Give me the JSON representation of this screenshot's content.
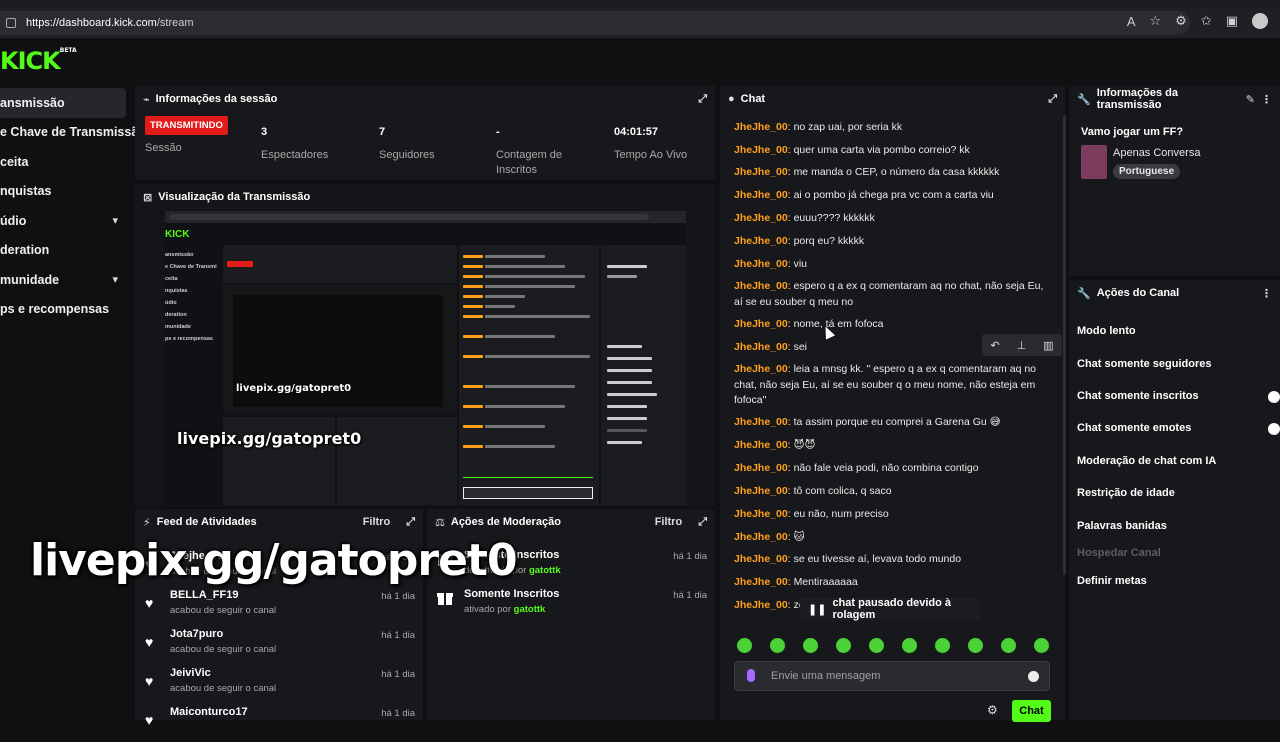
{
  "browser": {
    "url_host": "https://dashboard.kick.com",
    "url_path": "/stream"
  },
  "logo": "KICK",
  "logo_beta": "BETA",
  "sidebar": {
    "items": [
      {
        "label": "ansmissão",
        "active": true
      },
      {
        "label": "e Chave de Transmissão"
      },
      {
        "label": "ceita"
      },
      {
        "label": "nquistas"
      },
      {
        "label": "údio",
        "expandable": true
      },
      {
        "label": "deration"
      },
      {
        "label": "munidade",
        "expandable": true
      },
      {
        "label": "ps e recompensas"
      }
    ]
  },
  "session": {
    "title": "Informações da sessão",
    "status_badge": "TRANSMITINDO",
    "status_label": "Sessão",
    "viewers_value": "3",
    "viewers_label": "Espectadores",
    "followers_value": "7",
    "followers_label": "Seguidores",
    "subs_value": "-",
    "subs_label": "Contagem de Inscritos",
    "live_value": "04:01:57",
    "live_label": "Tempo Ao Vivo"
  },
  "preview": {
    "title": "Visualização da Transmissão",
    "overlay_text": "livepix.gg/gatopret0",
    "mini_url": "https://dashboard.kick.com/stream"
  },
  "feed": {
    "title": "Feed de Atividades",
    "filter": "Filtro",
    "items": [
      {
        "name": "Jhejhe_00",
        "sub": "acabou de seguir o canal",
        "time": "há 1 dia"
      },
      {
        "name": "BELLA_FF19",
        "sub": "acabou de seguir o canal",
        "time": "há 1 dia"
      },
      {
        "name": "Jota7puro",
        "sub": "acabou de seguir o canal",
        "time": "há 1 dia"
      },
      {
        "name": "JeiviVic",
        "sub": "acabou de seguir o canal",
        "time": "há 1 dia"
      },
      {
        "name": "Maiconturco17",
        "sub": "",
        "time": "há 1 dia"
      }
    ]
  },
  "moderation": {
    "title": "Ações de Moderação",
    "filter": "Filtro",
    "items": [
      {
        "name": "Somente Inscritos",
        "state": "desativado por",
        "by": "gatottk",
        "time": "há 1 dia"
      },
      {
        "name": "Somente Inscritos",
        "state": "ativado por",
        "by": "gatottk",
        "time": "há 1 dia"
      }
    ]
  },
  "overlay_big": "livepix.gg/gatopret0",
  "chat": {
    "title": "Chat",
    "messages": [
      {
        "user": "JheJhe_00",
        "text": "no zap uai, por seria kk"
      },
      {
        "user": "JheJhe_00",
        "text": "quer uma carta via pombo correio? kk"
      },
      {
        "user": "JheJhe_00",
        "text": "me manda o CEP, o número da casa kkkkkk"
      },
      {
        "user": "JheJhe_00",
        "text": "ai o pombo já chega pra vc com a carta viu"
      },
      {
        "user": "JheJhe_00",
        "text": "euuu???? kkkkkk"
      },
      {
        "user": "JheJhe_00",
        "text": "porq eu? kkkkk"
      },
      {
        "user": "JheJhe_00",
        "text": "viu"
      },
      {
        "user": "JheJhe_00",
        "text": "espero q a ex q comentaram aq no chat, não seja Eu, aí se eu souber q meu no"
      },
      {
        "user": "JheJhe_00",
        "text": "nome, tá em fofoca"
      },
      {
        "user": "JheJhe_00",
        "text": "sei"
      },
      {
        "user": "JheJhe_00",
        "text": "leia a mnsg kk. \" espero q a ex q comentaram aq no chat, não seja Eu, aí se eu souber q o meu nome, não esteja em fofoca\""
      },
      {
        "user": "JheJhe_00",
        "text": "ta assim porque eu comprei a Garena Gu 😅"
      },
      {
        "user": "JheJhe_00",
        "text": "😈😈"
      },
      {
        "user": "JheJhe_00",
        "text": "não fale veia podi, não combina contigo"
      },
      {
        "user": "JheJhe_00",
        "text": "tô com colica, q saco"
      },
      {
        "user": "JheJhe_00",
        "text": "eu não, num preciso"
      },
      {
        "user": "JheJhe_00",
        "text": "🐱"
      },
      {
        "user": "JheJhe_00",
        "text": "se eu tivesse aí, levava todo mundo"
      },
      {
        "user": "JheJhe_00",
        "text": "Mentiraaaaaa"
      },
      {
        "user": "JheJhe_00",
        "text": "zc"
      }
    ],
    "paused_text": "chat pausado devido à rolagem",
    "input_placeholder": "Envie uma mensagem",
    "send_label": "Chat"
  },
  "stream_info": {
    "title": "Informações da transmissão",
    "stream_title": "Vamo jogar um FF?",
    "category": "Apenas Conversa",
    "language": "Portuguese"
  },
  "channel_actions": {
    "title": "Ações do Canal",
    "items": [
      {
        "label": "Modo lento"
      },
      {
        "label": "Chat somente seguidores"
      },
      {
        "label": "Chat somente inscritos",
        "toggle": true
      },
      {
        "label": "Chat somente emotes",
        "toggle": true
      },
      {
        "label": "Moderação de chat com IA"
      },
      {
        "label": "Restrição de idade"
      },
      {
        "label": "Palavras banidas"
      },
      {
        "label": "Hospedar Canal",
        "disabled": true
      },
      {
        "label": "Definir metas"
      }
    ]
  },
  "colors": {
    "brand": "#53fc18",
    "live": "#e21b1b",
    "username": "#ff9f1c"
  }
}
